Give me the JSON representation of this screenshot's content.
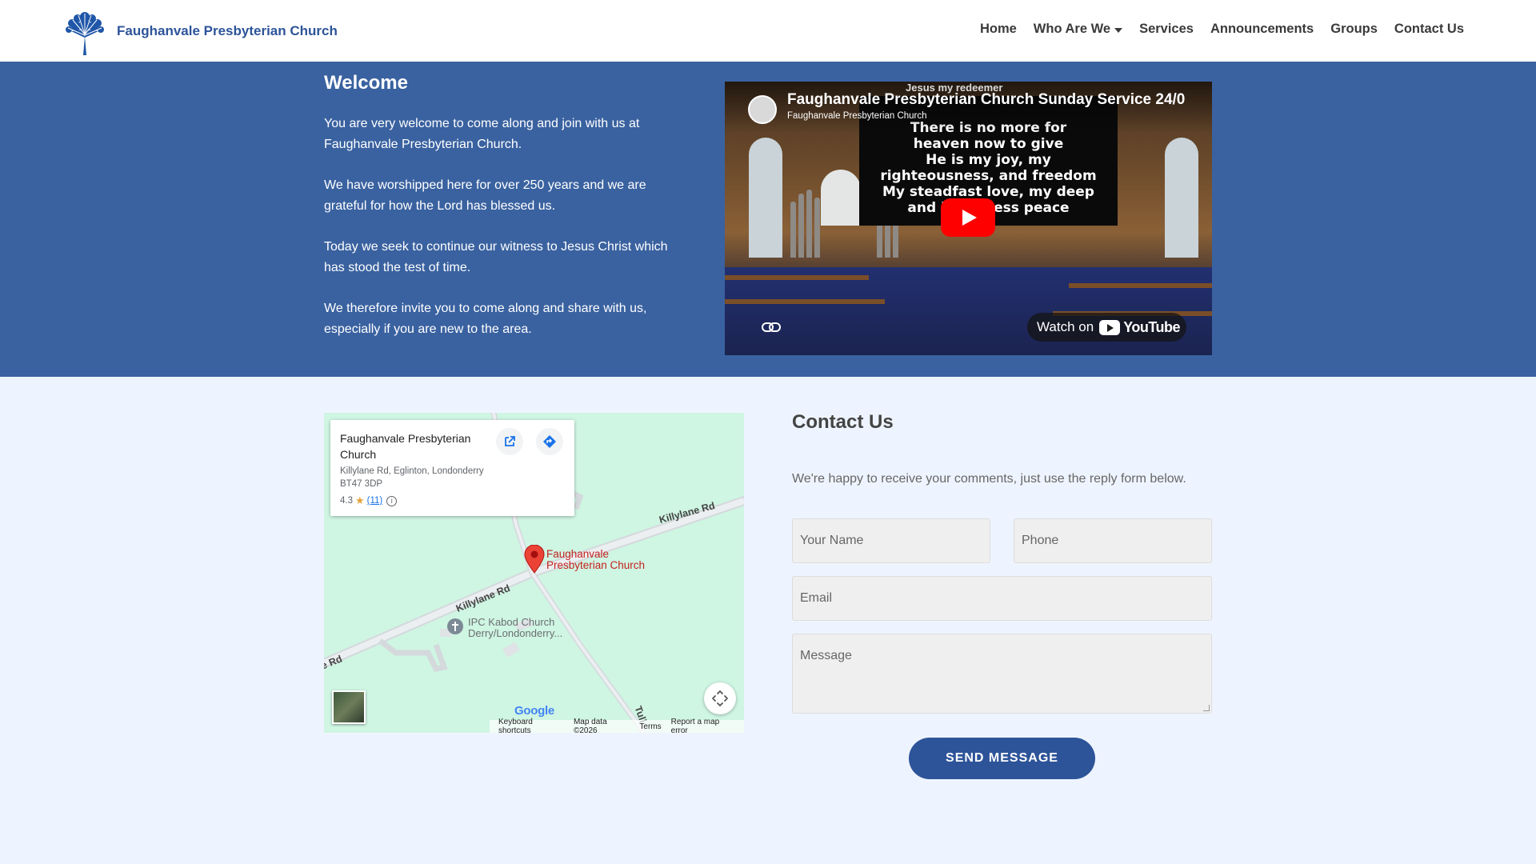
{
  "brand": {
    "name": "Faughanvale Presbyterian Church"
  },
  "nav": {
    "items": [
      {
        "label": "Home"
      },
      {
        "label": "Who Are We"
      },
      {
        "label": "Services"
      },
      {
        "label": "Announcements"
      },
      {
        "label": "Groups"
      },
      {
        "label": "Contact Us"
      }
    ]
  },
  "welcome": {
    "title": "Welcome",
    "paragraphs": [
      "You are very welcome to come along and join with us at Faughanvale Presbyterian Church.",
      "We have worshipped here for over 250 years and we are grateful for how the Lord has blessed us.",
      "Today we seek to continue our witness to Jesus Christ which has stood the test of time.",
      "We therefore invite you to come along and share with us, especially if you are new to the area."
    ]
  },
  "video": {
    "title": "Faughanvale Presbyterian Church Sunday Service 24/0",
    "channel": "Faughanvale Presbyterian Church",
    "lyrics": [
      "Jesus my redeemer",
      "There is no more for",
      "heaven now to give",
      "He is my joy, my",
      "righteousness, and freedom",
      "My steadfast love, my deep",
      "and boundless peace"
    ],
    "watch_on": "Watch on",
    "youtube": "YouTube"
  },
  "map": {
    "place_name": "Faughanvale Presbyterian Church",
    "address": "Killylane Rd, Eglinton, Londonderry BT47 3DP",
    "rating": "4.3",
    "review_count": "(11)",
    "pin_label": "Faughanvale Presbyterian Church",
    "poi_label": "IPC Kabod Church Derry/Londonderry...",
    "road_labels": [
      "Killylane Rd",
      "Killylane Rd",
      "e Rd",
      "Tull"
    ],
    "google": "Google",
    "footer": [
      "Keyboard shortcuts",
      "Map data ©2026",
      "Terms",
      "Report a map error"
    ]
  },
  "contact": {
    "title": "Contact Us",
    "subtitle": "We're happy to receive your comments, just use the reply form below.",
    "name_placeholder": "Your Name",
    "phone_placeholder": "Phone",
    "email_placeholder": "Email",
    "message_placeholder": "Message",
    "send_label": "SEND MESSAGE"
  },
  "colors": {
    "brand_blue": "#2d5499",
    "band_blue": "#3a62a0",
    "page_bg": "#eef4ff",
    "youtube_red": "#ff0000",
    "pin_red": "#c5221f"
  }
}
